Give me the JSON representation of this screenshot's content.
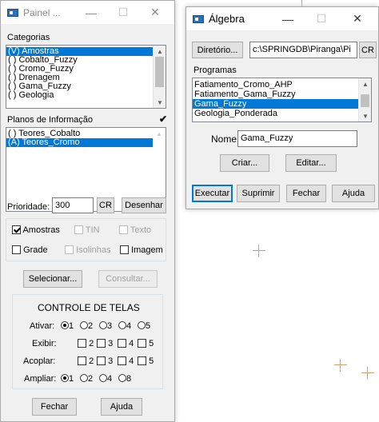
{
  "painel": {
    "title": "Painel ...",
    "minimize": "—",
    "maximize": "☐",
    "close": "✕",
    "categorias_label": "Categorias",
    "categorias": [
      "(V) Amostras",
      "( ) Cobalto_Fuzzy",
      "( ) Cromo_Fuzzy",
      "( ) Drenagem",
      "( ) Gama_Fuzzy",
      "( ) Geologia"
    ],
    "categorias_selected": 0,
    "planos_label": "Planos de Informação",
    "planos_check": "✔",
    "planos": [
      "( ) Teores_Cobalto",
      "(A) Teores_Cromo"
    ],
    "planos_selected": 1,
    "prioridade_label": "Prioridade:",
    "prioridade_value": "300",
    "cr_button": "CR",
    "desenhar_button": "Desenhar",
    "amostras": "Amostras",
    "tin": "TIN",
    "texto": "Texto",
    "grade": "Grade",
    "isolinhas": "Isolinhas",
    "imagem": "Imagem",
    "selecionar_button": "Selecionar...",
    "consultar_button": "Consultar...",
    "controle_title": "CONTROLE DE TELAS",
    "ativar_label": "Ativar:",
    "exibir_label": "Exibir:",
    "acoplar_label": "Acoplar:",
    "ampliar_label": "Ampliar:",
    "opt1": "1",
    "opt2": "2",
    "opt3": "3",
    "opt4": "4",
    "opt5": "5",
    "opt8": "8",
    "fechar_button": "Fechar",
    "ajuda_button": "Ajuda"
  },
  "algebra": {
    "title": "Álgebra",
    "minimize": "—",
    "maximize": "☐",
    "close": "✕",
    "diretorio_button": "Diretório...",
    "diretorio_value": "c:\\SPRINGDB\\Piranga\\Pi",
    "cr_button": "CR",
    "programas_label": "Programas",
    "programas": [
      "Fatiamento_Cromo_AHP",
      "Fatiamento_Gama_Fuzzy",
      "Gama_Fuzzy",
      "Geologia_Ponderada"
    ],
    "programas_selected": 2,
    "nome_label": "Nome:",
    "nome_value": "Gama_Fuzzy",
    "criar_button": "Criar...",
    "editar_button": "Editar...",
    "executar_button": "Executar",
    "suprimir_button": "Suprimir",
    "fechar_button": "Fechar",
    "ajuda_button": "Ajuda"
  },
  "colors": {
    "selection": "#0078d7",
    "dialog_bg": "#f0f0f0",
    "crosshair": "#d8a060"
  }
}
